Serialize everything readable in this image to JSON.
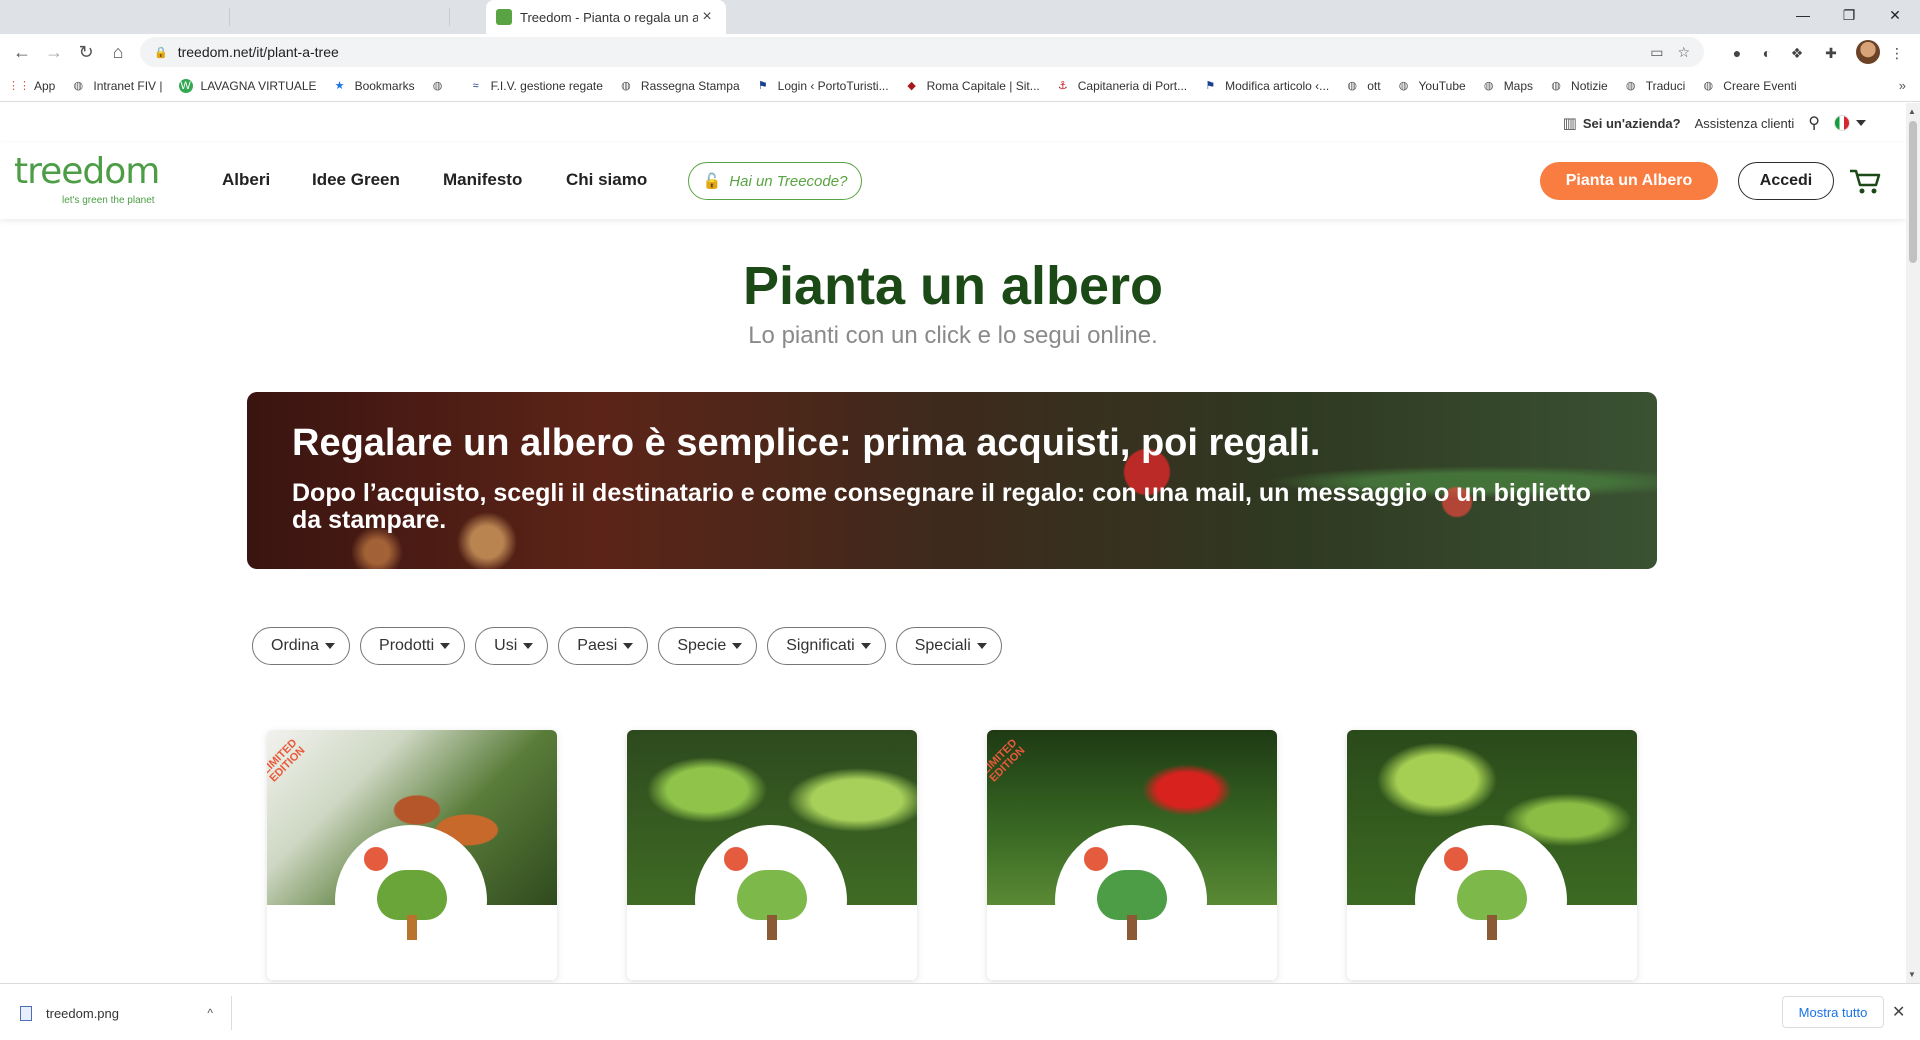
{
  "browser": {
    "tab_title": "Treedom - Pianta o regala un alb",
    "url": "treedom.net/it/plant-a-tree",
    "bookmarks": [
      {
        "label": "App",
        "icon": "apps-grid-icon"
      },
      {
        "label": "Intranet FIV |",
        "icon": "globe-icon"
      },
      {
        "label": "LAVAGNA VIRTUALE",
        "icon": "w-icon"
      },
      {
        "label": "Bookmarks",
        "icon": "star-icon"
      },
      {
        "label": "",
        "icon": "globe-icon"
      },
      {
        "label": "F.I.V. gestione regate",
        "icon": "fiv-icon"
      },
      {
        "label": "Rassegna Stampa",
        "icon": "globe-icon"
      },
      {
        "label": "Login ‹ PortoTuristi...",
        "icon": "flag-icon"
      },
      {
        "label": "Roma Capitale | Sit...",
        "icon": "shield-icon"
      },
      {
        "label": "Capitaneria di Port...",
        "icon": "anchor-icon"
      },
      {
        "label": "Modifica articolo ‹...",
        "icon": "flag-icon"
      },
      {
        "label": "ott",
        "icon": "globe-icon"
      },
      {
        "label": "YouTube",
        "icon": "globe-icon"
      },
      {
        "label": "Maps",
        "icon": "globe-icon"
      },
      {
        "label": "Notizie",
        "icon": "globe-icon"
      },
      {
        "label": "Traduci",
        "icon": "globe-icon"
      },
      {
        "label": "Creare Eventi",
        "icon": "globe-icon"
      }
    ],
    "bookmarks_more": "»"
  },
  "topbar": {
    "business": "Sei un'azienda?",
    "support": "Assistenza clienti"
  },
  "nav": {
    "logo_text": "treedom",
    "logo_tagline": "let's green the planet",
    "links": [
      "Alberi",
      "Idee Green",
      "Manifesto",
      "Chi siamo"
    ],
    "treecode": "Hai un Treecode?",
    "plant_button": "Pianta un Albero",
    "login_button": "Accedi"
  },
  "hero": {
    "title": "Pianta un albero",
    "subtitle": "Lo pianti con un click e lo segui online."
  },
  "banner": {
    "title": "Regalare un albero è semplice: prima acquisti, poi regali.",
    "text": "Dopo l’acquisto, scegli il destinatario e come consegnare il regalo: con una mail, un messaggio o un biglietto da stampare."
  },
  "filters": [
    "Ordina",
    "Prodotti",
    "Usi",
    "Paesi",
    "Specie",
    "Significati",
    "Speciali"
  ],
  "cards": [
    {
      "ribbon": "LIMITED EDITION",
      "photo": "cocoa-pods"
    },
    {
      "ribbon": "",
      "photo": "green-leaves"
    },
    {
      "ribbon": "LIMITED EDITION",
      "photo": "red-flower"
    },
    {
      "ribbon": "",
      "photo": "green-leaves"
    }
  ],
  "downloads": {
    "file": "treedom.png",
    "show_all": "Mostra tutto"
  },
  "colors": {
    "brand_green": "#4c9d46",
    "title_green": "#1c4a17",
    "accent_orange": "#f97c40"
  }
}
